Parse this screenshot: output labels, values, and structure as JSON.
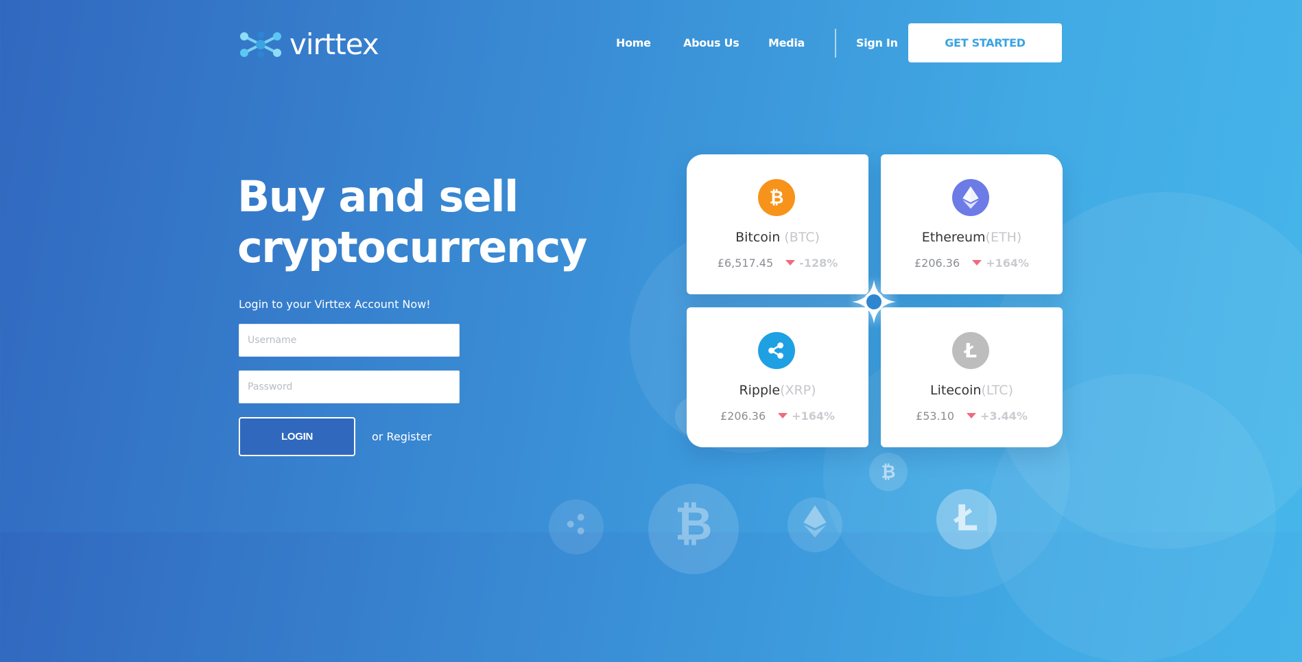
{
  "brand": {
    "name": "virttex"
  },
  "nav": {
    "items": [
      "Home",
      "Abous Us",
      "Media"
    ],
    "sign_in": "Sign In",
    "get_started": "GET STARTED"
  },
  "hero": {
    "title_line1": "Buy and sell",
    "title_line2": "cryptocurrency",
    "subtitle": "Login to your Virttex Account Now!"
  },
  "login": {
    "username_placeholder": "Username",
    "password_placeholder": "Password",
    "button": "LOGIN",
    "register": "or Register"
  },
  "coins": [
    {
      "name": "Bitcoin ",
      "symbol": "(BTC)",
      "price": "£6,517.45",
      "change": "-128%",
      "icon": "bitcoin-icon",
      "color": "#f7931a"
    },
    {
      "name": "Ethereum",
      "symbol": "(ETH)",
      "price": "£206.36",
      "change": "+164%",
      "icon": "ethereum-icon",
      "color": "#6c7be6"
    },
    {
      "name": "Ripple",
      "symbol": "(XRP)",
      "price": "£206.36",
      "change": "+164%",
      "icon": "ripple-icon",
      "color": "#1ea0e3"
    },
    {
      "name": "Litecoin",
      "symbol": "(LTC)",
      "price": "£53.10",
      "change": "+3.44%",
      "icon": "litecoin-icon",
      "color": "#bdbdbd"
    }
  ],
  "colors": {
    "accent": "#3aa3e2",
    "down": "#ef6b7c",
    "login_bg": "#3068bd"
  }
}
